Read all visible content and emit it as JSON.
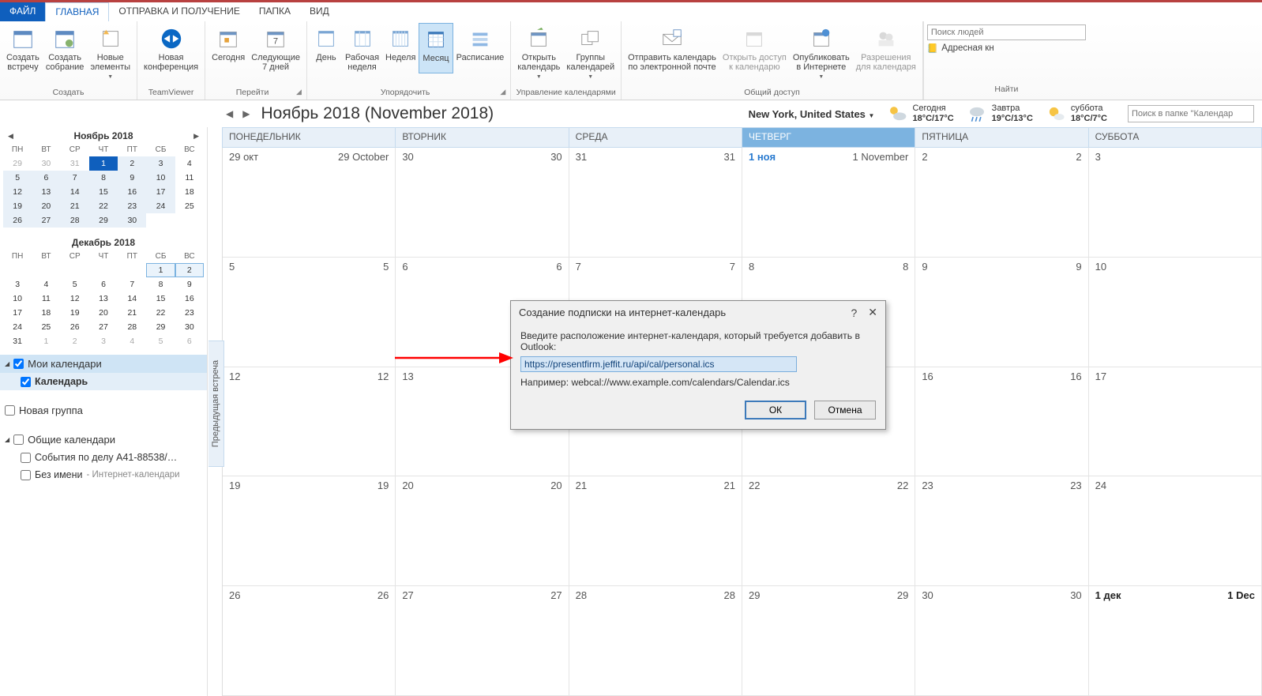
{
  "tabs": {
    "file": "ФАЙЛ",
    "home": "ГЛАВНАЯ",
    "sendrecv": "ОТПРАВКА И ПОЛУЧЕНИЕ",
    "folder": "ПАПКА",
    "view": "ВИД"
  },
  "ribbon": {
    "create": {
      "label": "Создать",
      "appt": "Создать\nвстречу",
      "meet": "Создать\nсобрание",
      "items": "Новые\nэлементы"
    },
    "tv": {
      "label": "TeamViewer",
      "meet": "Новая\nконференция"
    },
    "goto": {
      "label": "Перейти",
      "today": "Сегодня",
      "next7": "Следующие\n7 дней"
    },
    "arrange": {
      "label": "Упорядочить",
      "day": "День",
      "workweek": "Рабочая\nнеделя",
      "week": "Неделя",
      "month": "Месяц",
      "schedule": "Расписание"
    },
    "manage": {
      "label": "Управление календарями",
      "open": "Открыть\nкалендарь",
      "groups": "Группы\nкалендарей"
    },
    "share": {
      "label": "Общий доступ",
      "send": "Отправить календарь\nпо электронной почте",
      "openacc": "Открыть доступ\nк календарю",
      "publish": "Опубликовать\nв Интернете",
      "perms": "Разрешения\nдля календаря"
    },
    "find": {
      "label": "Найти",
      "search_ph": "Поиск людей",
      "ab": "Адресная кн"
    }
  },
  "nav": {
    "title": "Ноябрь 2018 (November 2018)",
    "search_ph": "Поиск в папке \"Календар"
  },
  "weather": {
    "loc": "New York, United States",
    "d0": {
      "label": "Сегодня",
      "temp": "18°C/17°C"
    },
    "d1": {
      "label": "Завтра",
      "temp": "19°C/13°C"
    },
    "d2": {
      "label": "суббота",
      "temp": "18°C/7°C"
    }
  },
  "mini1": {
    "title": "Ноябрь 2018",
    "dow": [
      "ПН",
      "ВТ",
      "СР",
      "ЧТ",
      "ПТ",
      "СБ",
      "ВС"
    ],
    "rows": [
      [
        {
          "n": 29,
          "c": "off"
        },
        {
          "n": 30,
          "c": "off"
        },
        {
          "n": 31,
          "c": "off"
        },
        {
          "n": 1,
          "c": "sel"
        },
        {
          "n": 2,
          "c": "inmonth"
        },
        {
          "n": 3,
          "c": "inmonth"
        },
        {
          "n": 4,
          "c": ""
        }
      ],
      [
        {
          "n": 5,
          "c": "inmonth"
        },
        {
          "n": 6,
          "c": "inmonth"
        },
        {
          "n": 7,
          "c": "inmonth"
        },
        {
          "n": 8,
          "c": "inmonth"
        },
        {
          "n": 9,
          "c": "inmonth"
        },
        {
          "n": 10,
          "c": "inmonth"
        },
        {
          "n": 11,
          "c": ""
        }
      ],
      [
        {
          "n": 12,
          "c": "inmonth"
        },
        {
          "n": 13,
          "c": "inmonth"
        },
        {
          "n": 14,
          "c": "inmonth"
        },
        {
          "n": 15,
          "c": "inmonth"
        },
        {
          "n": 16,
          "c": "inmonth"
        },
        {
          "n": 17,
          "c": "inmonth"
        },
        {
          "n": 18,
          "c": ""
        }
      ],
      [
        {
          "n": 19,
          "c": "inmonth"
        },
        {
          "n": 20,
          "c": "inmonth"
        },
        {
          "n": 21,
          "c": "inmonth"
        },
        {
          "n": 22,
          "c": "inmonth"
        },
        {
          "n": 23,
          "c": "inmonth"
        },
        {
          "n": 24,
          "c": "inmonth"
        },
        {
          "n": 25,
          "c": ""
        }
      ],
      [
        {
          "n": 26,
          "c": "inmonth"
        },
        {
          "n": 27,
          "c": "inmonth"
        },
        {
          "n": 28,
          "c": "inmonth"
        },
        {
          "n": 29,
          "c": "inmonth"
        },
        {
          "n": 30,
          "c": "inmonth"
        },
        {
          "n": "",
          "c": ""
        },
        {
          "n": "",
          "c": ""
        }
      ]
    ]
  },
  "mini2": {
    "title": "Декабрь 2018",
    "dow": [
      "ПН",
      "ВТ",
      "СР",
      "ЧТ",
      "ПТ",
      "СБ",
      "ВС"
    ],
    "rows": [
      [
        {
          "n": ""
        },
        {
          "n": ""
        },
        {
          "n": ""
        },
        {
          "n": ""
        },
        {
          "n": ""
        },
        {
          "n": 1,
          "c": "hov"
        },
        {
          "n": 2,
          "c": "hov"
        }
      ],
      [
        {
          "n": 3
        },
        {
          "n": 4
        },
        {
          "n": 5
        },
        {
          "n": 6
        },
        {
          "n": 7
        },
        {
          "n": 8
        },
        {
          "n": 9
        }
      ],
      [
        {
          "n": 10
        },
        {
          "n": 11
        },
        {
          "n": 12
        },
        {
          "n": 13
        },
        {
          "n": 14
        },
        {
          "n": 15
        },
        {
          "n": 16
        }
      ],
      [
        {
          "n": 17
        },
        {
          "n": 18
        },
        {
          "n": 19
        },
        {
          "n": 20
        },
        {
          "n": 21
        },
        {
          "n": 22
        },
        {
          "n": 23
        }
      ],
      [
        {
          "n": 24
        },
        {
          "n": 25
        },
        {
          "n": 26
        },
        {
          "n": 27
        },
        {
          "n": 28
        },
        {
          "n": 29
        },
        {
          "n": 30
        }
      ],
      [
        {
          "n": 31
        },
        {
          "n": 1,
          "c": "off"
        },
        {
          "n": 2,
          "c": "off"
        },
        {
          "n": 3,
          "c": "off"
        },
        {
          "n": 4,
          "c": "off"
        },
        {
          "n": 5,
          "c": "off"
        },
        {
          "n": 6,
          "c": "off"
        }
      ]
    ]
  },
  "side": {
    "mycal": "Мои календари",
    "cal": "Календарь",
    "newgroup": "Новая группа",
    "shared": "Общие календари",
    "case": "События по делу А41-88538/…",
    "unnamed": "Без имени",
    "unnamed_src": "Интернет-календари"
  },
  "prevtab": "Предыдущая встреча",
  "dow": [
    "ПОНЕДЕЛЬНИК",
    "ВТОРНИК",
    "СРЕДА",
    "ЧЕТВЕРГ",
    "ПЯТНИЦА",
    "СУББОТА"
  ],
  "grid": [
    [
      {
        "L": "29 окт",
        "R": "29 October"
      },
      {
        "L": "30",
        "R": "30"
      },
      {
        "L": "31",
        "R": "31"
      },
      {
        "L": "1 ноя",
        "R": "1 November",
        "today": true
      },
      {
        "L": "2",
        "R": "2"
      },
      {
        "L": "3",
        "R": ""
      }
    ],
    [
      {
        "L": "5",
        "R": "5"
      },
      {
        "L": "6",
        "R": "6"
      },
      {
        "L": "7",
        "R": "7"
      },
      {
        "L": "8",
        "R": "8"
      },
      {
        "L": "9",
        "R": "9"
      },
      {
        "L": "10",
        "R": ""
      }
    ],
    [
      {
        "L": "12",
        "R": "12"
      },
      {
        "L": "13",
        "R": ""
      },
      {
        "L": "",
        "R": ""
      },
      {
        "L": "",
        "R": ""
      },
      {
        "L": "16",
        "R": "16"
      },
      {
        "L": "17",
        "R": ""
      }
    ],
    [
      {
        "L": "19",
        "R": "19"
      },
      {
        "L": "20",
        "R": "20"
      },
      {
        "L": "21",
        "R": "21"
      },
      {
        "L": "22",
        "R": "22"
      },
      {
        "L": "23",
        "R": "23"
      },
      {
        "L": "24",
        "R": ""
      }
    ],
    [
      {
        "L": "26",
        "R": "26"
      },
      {
        "L": "27",
        "R": "27"
      },
      {
        "L": "28",
        "R": "28"
      },
      {
        "L": "29",
        "R": "29"
      },
      {
        "L": "30",
        "R": "30"
      },
      {
        "L": "1 дек",
        "R": "1 Dec",
        "bold": true
      }
    ]
  ],
  "dialog": {
    "title": "Создание подписки на интернет-календарь",
    "prompt": "Введите расположение интернет-календаря, который требуется добавить в Outlook:",
    "value": "https://presentfirm.jeffit.ru/api/cal/personal.ics",
    "example": "Например: webcal://www.example.com/calendars/Calendar.ics",
    "ok": "ОК",
    "cancel": "Отмена"
  }
}
